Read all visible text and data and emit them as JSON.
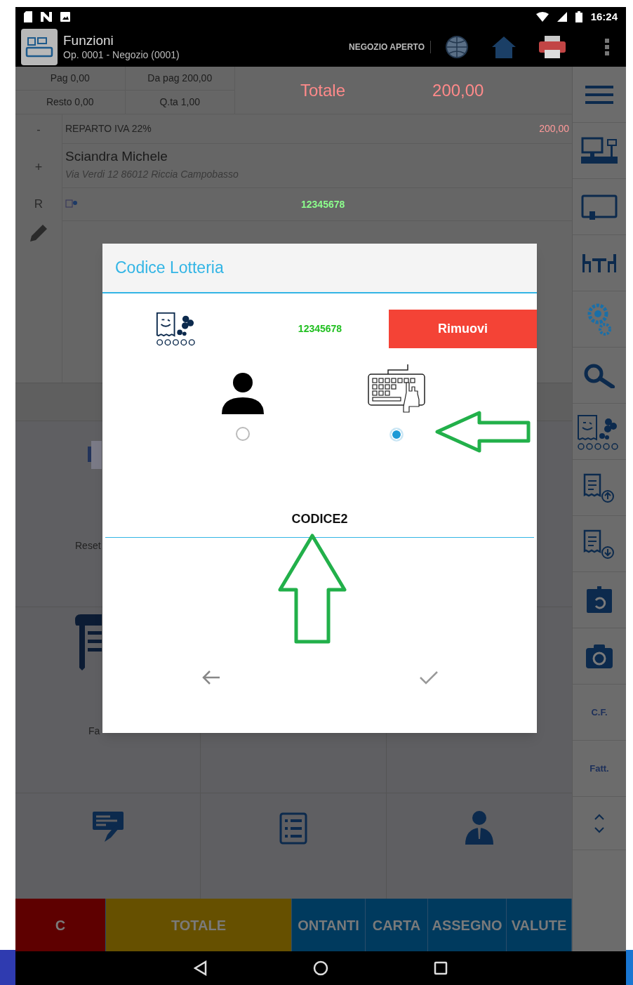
{
  "status_bar": {
    "time": "16:24"
  },
  "app_bar": {
    "title": "Funzioni",
    "subtitle": "Op. 0001 - Negozio (0001)",
    "store_status": "NEGOZIO APERTO"
  },
  "summary": {
    "paid": "Pag 0,00",
    "to_pay": "Da pag 200,00",
    "change": "Resto 0,00",
    "quantity": "Q.ta 1,00",
    "total_label": "Totale",
    "total_value": "200,00"
  },
  "side_controls": [
    "-",
    "+",
    "R"
  ],
  "receipt": {
    "line": {
      "description": "REPARTO IVA 22%",
      "amount": "200,00"
    },
    "customer": {
      "name": "Sciandra Michele",
      "address": "Via Verdi 12 86012 Riccia Campobasso"
    },
    "lottery_code": "12345678"
  },
  "grid_labels": [
    "Reset",
    "Fa"
  ],
  "right_toolbar": {
    "labels": [
      "C.F.",
      "Fatt."
    ]
  },
  "payment_buttons": [
    {
      "label": "C",
      "color": "#5e0000"
    },
    {
      "label": "TOTALE",
      "color": "#665000"
    },
    {
      "label": "ONTANTI",
      "color": "#003a5e"
    },
    {
      "label": "CARTA",
      "color": "#003a5e"
    },
    {
      "label": "ASSEGNO",
      "color": "#003a5e"
    },
    {
      "label": "VALUTE",
      "color": "#003a5e"
    }
  ],
  "dialog": {
    "title": "Codice Lotteria",
    "code": "12345678",
    "remove_button": "Rimuovi",
    "options": [
      {
        "kind": "person",
        "selected": false
      },
      {
        "kind": "keyboard",
        "selected": true
      }
    ],
    "input": {
      "value": "CODICE2"
    }
  }
}
